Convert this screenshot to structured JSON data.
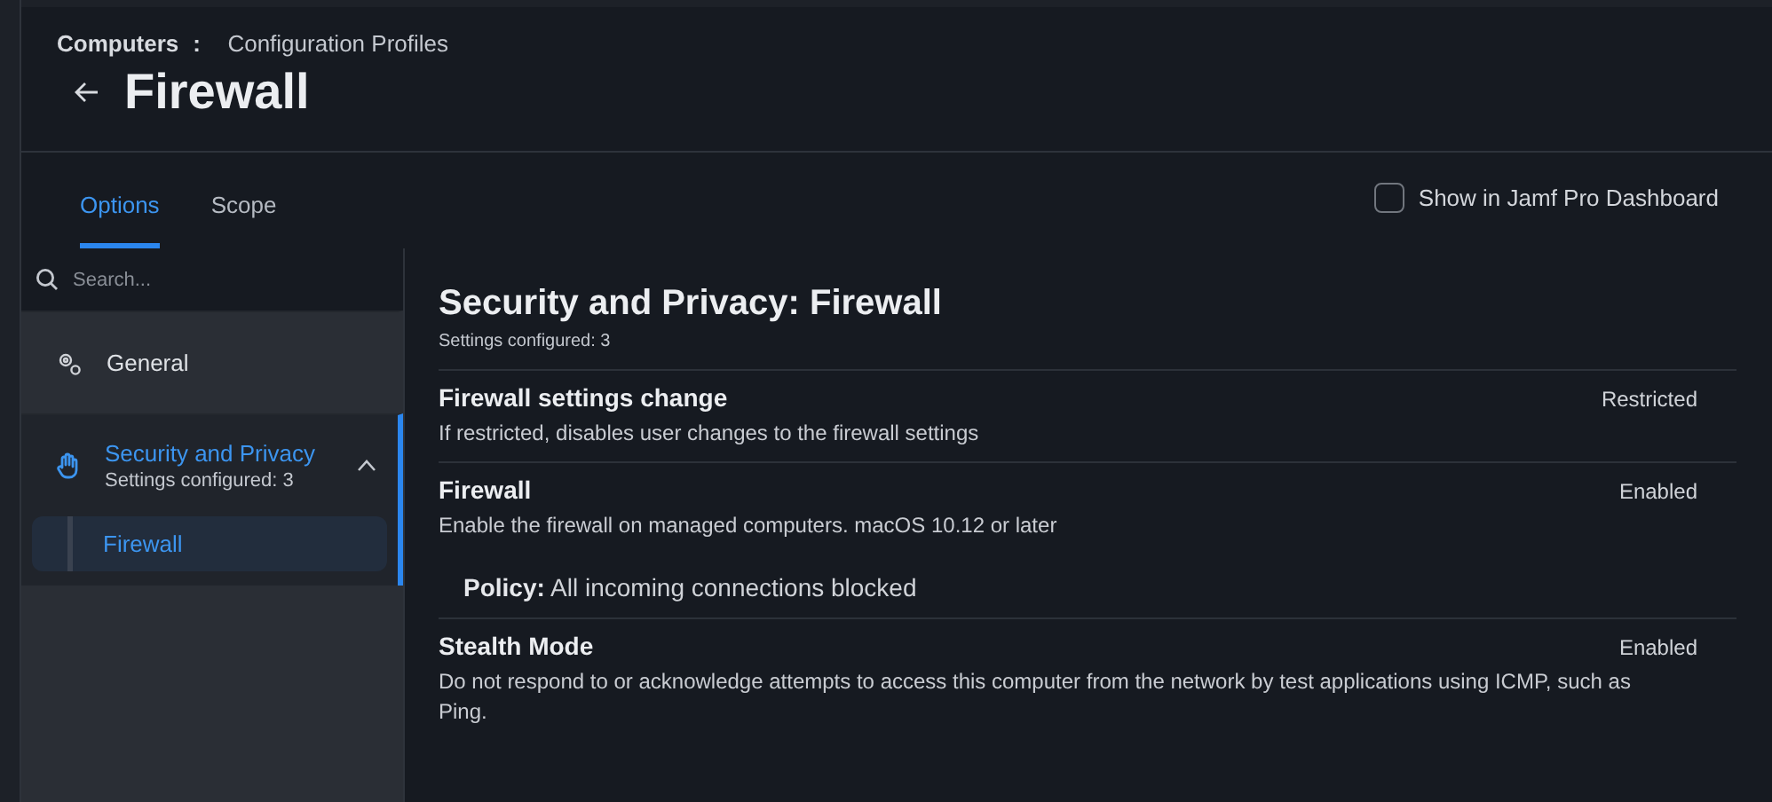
{
  "breadcrumb": {
    "parent": "Computers",
    "separator": ":",
    "current": "Configuration Profiles"
  },
  "title": "Firewall",
  "tabs": [
    {
      "label": "Options",
      "selected": true
    },
    {
      "label": "Scope",
      "selected": false
    }
  ],
  "dashboard_checkbox": {
    "label": "Show in Jamf Pro Dashboard",
    "checked": false
  },
  "search": {
    "placeholder": "Search..."
  },
  "sidebar": {
    "items": [
      {
        "label": "General",
        "kind": "gears",
        "selected": false
      },
      {
        "label": "Security and Privacy",
        "kind": "hand",
        "selected": true,
        "subtitle": "Settings configured: 3",
        "expanded": true,
        "children": [
          {
            "label": "Firewall",
            "selected": true
          }
        ]
      }
    ]
  },
  "content": {
    "title": "Security and Privacy: Firewall",
    "subtitle": "Settings configured: 3",
    "settings": [
      {
        "name": "Firewall settings change",
        "description": "If restricted, disables user changes to the firewall settings",
        "value": "Restricted"
      },
      {
        "name": "Firewall",
        "description": "Enable the firewall on managed computers. macOS 10.12 or later",
        "value": "Enabled",
        "detail_label": "Policy:",
        "detail_value": "All incoming connections blocked"
      },
      {
        "name": "Stealth Mode",
        "description": "Do not respond to or acknowledge attempts to access this computer from the network by test applications using ICMP, such as Ping.",
        "value": "Enabled"
      }
    ]
  }
}
